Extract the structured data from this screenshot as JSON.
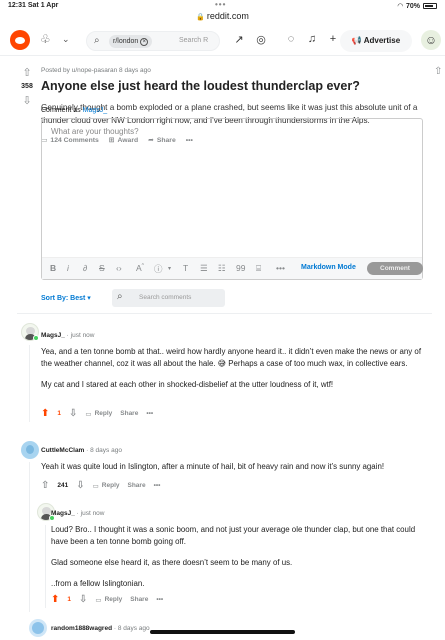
{
  "status_bar": {
    "time": "12:31",
    "date": "Sat 1 Apr",
    "battery": "70%"
  },
  "browser": {
    "url": "reddit.com"
  },
  "nav": {
    "subreddit_chip": "r/london",
    "search_placeholder": "Search R",
    "advertise_label": "Advertise"
  },
  "post": {
    "score": "358",
    "meta": "Posted by u/nope-pasaran 8 days ago",
    "title": "Anyone else just heard the loudest thunderclap ever?",
    "body": "Genuinely thought a bomb exploded or a plane crashed, but seems like it was just this absolute unit of a thunder cloud over NW London right now, and I've been through thunderstorms in the Alps.",
    "comments_label": "124 Comments",
    "award_label": "Award",
    "share_label": "Share",
    "more_label": "•••"
  },
  "editor": {
    "comment_as_label": "Comment as",
    "comment_as_user": "MagsJ_",
    "placeholder": "What are your thoughts?",
    "markdown_mode": "Markdown Mode",
    "comment_button": "Comment"
  },
  "sort": {
    "label": "Sort By: Best",
    "search_placeholder": "Search comments"
  },
  "comments": [
    {
      "author": "MagsJ_",
      "time": "· just now",
      "paragraphs": [
        "Yea, and a ten tonne bomb at that.. weird how hardly anyone heard it.. it didn’t even make the news or any of the weather channel, coz it was all about the hale. 😅 Perhaps a case of too much wax, in collective ears.",
        "My cat and I stared at each other in shocked-disbelief at the utter loudness of it, wtf!"
      ],
      "score": "1",
      "reply": "Reply",
      "share": "Share",
      "more": "•••"
    },
    {
      "author": "CuttleMcClam",
      "time": "· 8 days ago",
      "paragraphs": [
        "Yeah it was quite loud in Islington, after a minute of hail, bit of heavy rain and now it’s sunny again!"
      ],
      "score": "241",
      "reply": "Reply",
      "share": "Share",
      "more": "•••"
    },
    {
      "author": "MagsJ_",
      "time": "· just now",
      "paragraphs": [
        "Loud? Bro.. I thought it was a sonic boom, and not just your average ole thunder clap, but one that could have been a ten tonne bomb going off.",
        "Glad someone else heard it, as there doesn’t seem to be many of us.",
        "..from a fellow Islingtonian."
      ],
      "score": "1",
      "reply": "Reply",
      "share": "Share",
      "more": "•••"
    },
    {
      "author": "random1888wagred",
      "time": "· 8 days ago"
    }
  ]
}
